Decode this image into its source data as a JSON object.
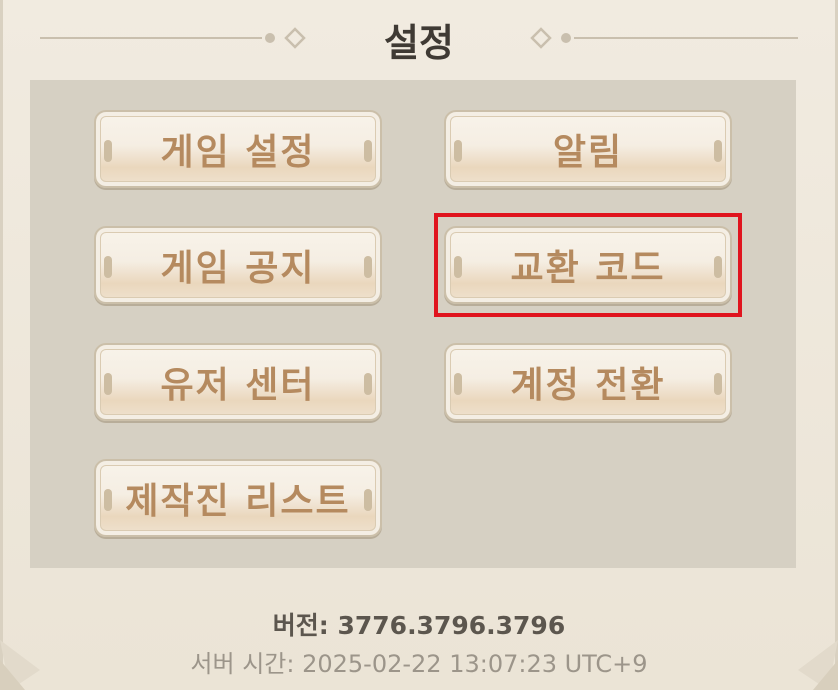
{
  "header": {
    "title": "설정"
  },
  "menu": {
    "game_settings": "게임 설정",
    "notifications": "알림",
    "game_notice": "게임 공지",
    "redeem_code": "교환 코드",
    "user_center": "유저 센터",
    "switch_account": "계정 전환",
    "credits": "제작진 리스트"
  },
  "footer": {
    "version": "버전: 3776.3796.3796",
    "server_time": "서버 시간: 2025-02-22 13:07:23 UTC+9"
  },
  "colors": {
    "highlight": "#e0141e",
    "button_text": "#b58a5f",
    "panel": "#d6d0c3"
  }
}
